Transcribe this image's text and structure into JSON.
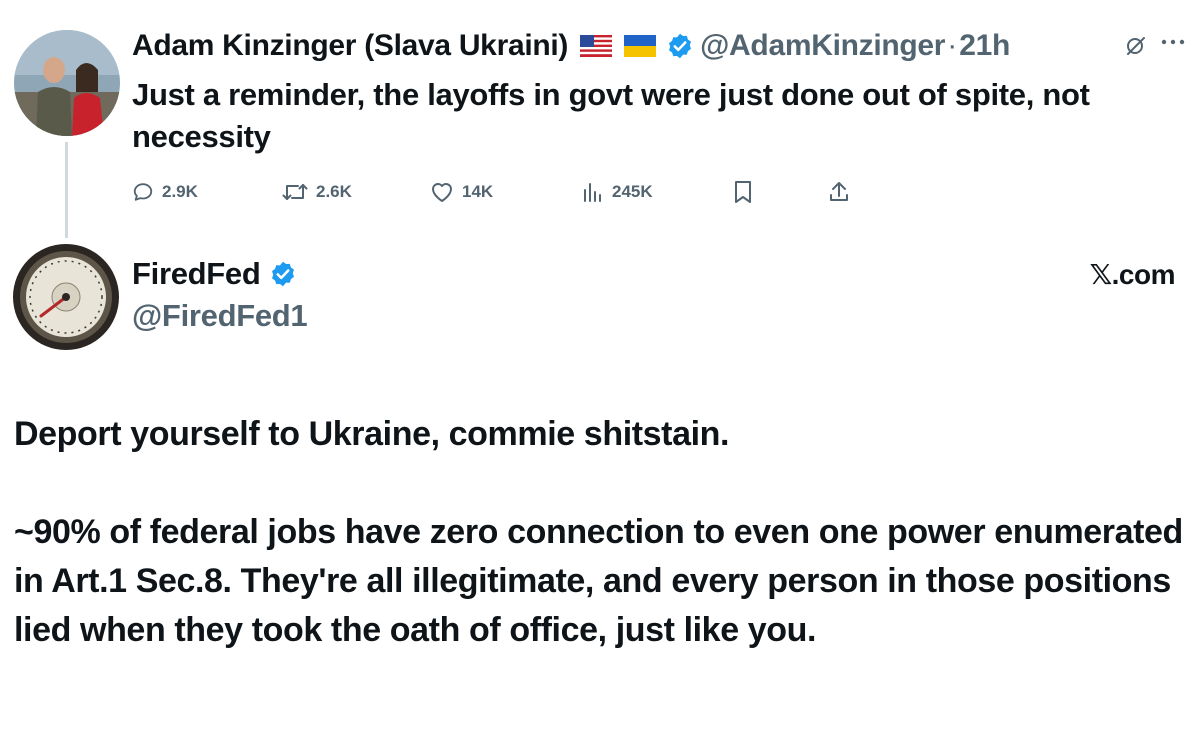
{
  "tweet1": {
    "display_name": "Adam Kinzinger (Slava Ukraini)",
    "flag1": "us-flag-icon",
    "flag2": "ukraine-flag-icon",
    "handle": "@AdamKinzinger",
    "separator": "·",
    "time": "21h",
    "text": "Just a reminder, the layoffs in govt were just done out of spite, not necessity",
    "actions": {
      "replies": "2.9K",
      "reposts": "2.6K",
      "likes": "14K",
      "views": "245K"
    }
  },
  "tweet2": {
    "display_name": "FiredFed",
    "handle": "@FiredFed1",
    "source": "𝕏.com",
    "paragraphs": [
      "Deport yourself to Ukraine, commie shitstain.",
      "~90% of federal jobs have zero connection to even one power enumerated in Art.1 Sec.8. They're all illegitimate, and every person in those positions lied when they took the oath of office, just like you."
    ]
  },
  "colors": {
    "text": "#0f1419",
    "secondary": "#536471",
    "verified": "#1d9bf0",
    "thread_line": "#cfd9de"
  }
}
